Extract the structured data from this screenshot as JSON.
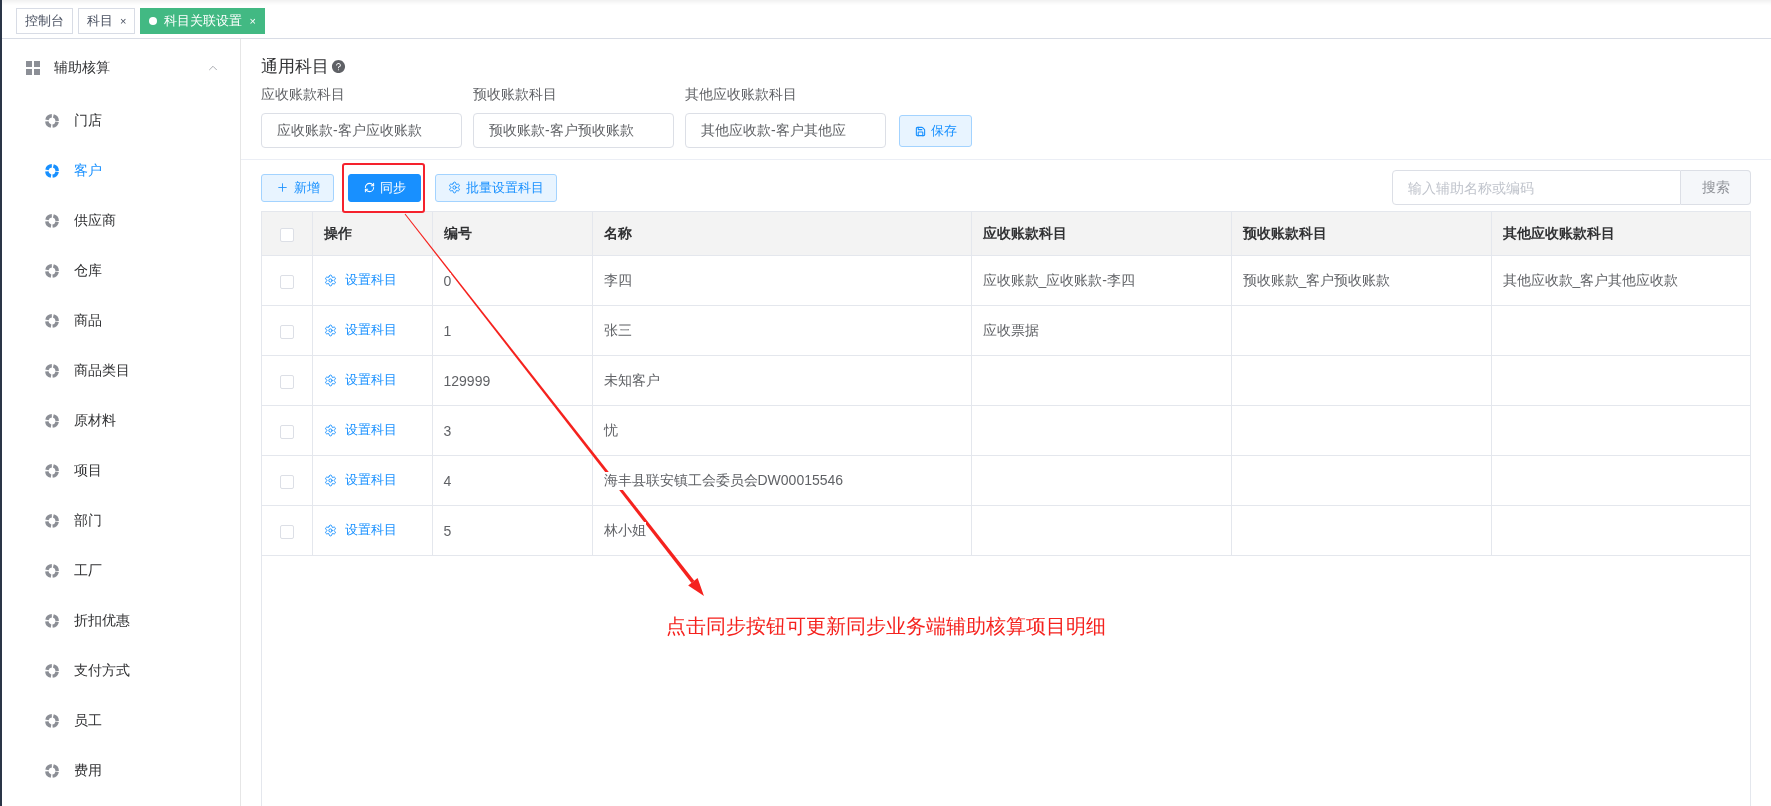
{
  "tabs": [
    {
      "label": "控制台",
      "selected": false
    },
    {
      "label": "科目",
      "close": "×",
      "selected": false
    },
    {
      "label": "科目关联设置",
      "close": "×",
      "selected": true
    }
  ],
  "sidebar": {
    "title": "辅助核算",
    "expanded": true,
    "items": [
      {
        "label": "门店",
        "selected": false
      },
      {
        "label": "客户",
        "selected": true
      },
      {
        "label": "供应商",
        "selected": false
      },
      {
        "label": "仓库",
        "selected": false
      },
      {
        "label": "商品",
        "selected": false
      },
      {
        "label": "商品类目",
        "selected": false
      },
      {
        "label": "原材料",
        "selected": false
      },
      {
        "label": "项目",
        "selected": false
      },
      {
        "label": "部门",
        "selected": false
      },
      {
        "label": "工厂",
        "selected": false
      },
      {
        "label": "折扣优惠",
        "selected": false
      },
      {
        "label": "支付方式",
        "selected": false
      },
      {
        "label": "员工",
        "selected": false
      },
      {
        "label": "费用",
        "selected": false
      }
    ]
  },
  "general": {
    "title": "通用科目",
    "fields": [
      {
        "label": "应收账款科目",
        "value": "应收账款-客户应收账款"
      },
      {
        "label": "预收账款科目",
        "value": "预收账款-客户预收账款"
      },
      {
        "label": "其他应收账款科目",
        "value": "其他应收款-客户其他应"
      }
    ],
    "save_button": "保存"
  },
  "toolbar": {
    "buttons": [
      {
        "kind": "add",
        "label": "新增"
      },
      {
        "kind": "sync",
        "label": "同步",
        "highlighted": true
      },
      {
        "kind": "batch",
        "label": "批量设置科目"
      }
    ],
    "search": {
      "placeholder": "输入辅助名称或编码",
      "button": "搜索"
    }
  },
  "table": {
    "all_checked": false,
    "columns": [
      "操作",
      "编号",
      "名称",
      "应收账款科目",
      "预收账款科目",
      "其他应收账款科目"
    ],
    "rows": [
      {
        "checked": false,
        "action": "设置科目",
        "code": "0",
        "name": "李四",
        "receivable": "应收账款_应收账款-李四",
        "advance": "预收账款_客户预收账款",
        "other": "其他应收款_客户其他应收款"
      },
      {
        "checked": false,
        "action": "设置科目",
        "code": "1",
        "name": "张三",
        "receivable": "应收票据"
      },
      {
        "checked": false,
        "action": "设置科目",
        "code": "129999",
        "name": "未知客户"
      },
      {
        "checked": false,
        "action": "设置科目",
        "code": "3",
        "name": "忧"
      },
      {
        "checked": false,
        "action": "设置科目",
        "code": "4",
        "name": "海丰县联安镇工会委员会DW00015546"
      },
      {
        "checked": false,
        "action": "设置科目",
        "code": "5",
        "name": "林小姐"
      }
    ]
  },
  "annotation": {
    "text": "点击同步按钮可更新同步业务端辅助核算项目明细"
  }
}
